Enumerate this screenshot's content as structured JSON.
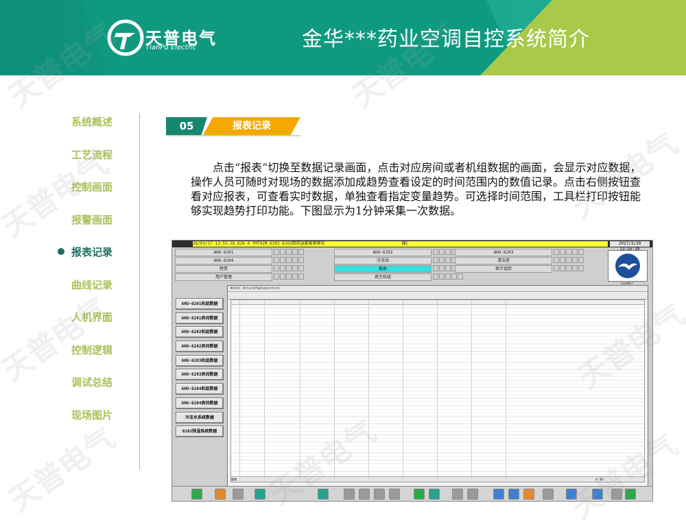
{
  "header": {
    "logo_text": "天普电气",
    "logo_sub": "TianPu Electric",
    "title": "金华***药业空调自控系统简介",
    "colors": {
      "primary": "#0f9a80",
      "accent": "#a8c94a"
    }
  },
  "nav": {
    "items": [
      {
        "label": "系统概述",
        "active": false
      },
      {
        "label": "工艺流程",
        "active": false
      },
      {
        "label": "控制画面",
        "active": false
      },
      {
        "label": "报警画面",
        "active": false
      },
      {
        "label": "报表记录",
        "active": true
      },
      {
        "label": "曲线记录",
        "active": false
      },
      {
        "label": "人机界面",
        "active": false
      },
      {
        "label": "控制逻辑",
        "active": false
      },
      {
        "label": "调试总结",
        "active": false
      },
      {
        "label": "现场图片",
        "active": false
      }
    ]
  },
  "section": {
    "number": "05",
    "title": "报表记录",
    "paragraph": "点击“报表”切换至数据记录画面，点击对应房间或者机组数据的画面，会显示对应数据，操作人员可随时对现场的数据添加成趋势查看设定的时间范围内的数值记录。点击右侧按钮查看对应报表，可查看实时数据，单独查看指定变量趋势。可选择时间范围，工具栏打印按钮能够实现趋势打印功能。下图显示为1分钟采集一次数据。"
  },
  "screenshot": {
    "alarm_bar": "28/03/17 13:55:28.826 0  TMT02M_6203                        6203回风湿度高限警告",
    "alarm_code": "偏C",
    "clock": "2017/3/20 13:55:39",
    "grid": [
      {
        "label": "AHU-6201",
        "col": 0,
        "row": 0,
        "cyan": false
      },
      {
        "label": "AHU-6202",
        "col": 1,
        "row": 0,
        "cyan": false
      },
      {
        "label": "AHU-6203",
        "col": 2,
        "row": 0,
        "cyan": false
      },
      {
        "label": "AHU-6204",
        "col": 0,
        "row": 1,
        "cyan": false
      },
      {
        "label": "冷冻站",
        "col": 1,
        "row": 1,
        "cyan": false
      },
      {
        "label": "清洁室",
        "col": 2,
        "row": 1,
        "cyan": false
      },
      {
        "label": "趋势",
        "col": 0,
        "row": 2,
        "cyan": false
      },
      {
        "label": "报表",
        "col": 1,
        "row": 2,
        "cyan": true
      },
      {
        "label": "审计追踪",
        "col": 2,
        "row": 2,
        "cyan": false
      },
      {
        "label": "用户管理",
        "col": 0,
        "row": 3,
        "cyan": false
      },
      {
        "label": "真空机组",
        "col": 1,
        "row": 3,
        "cyan": false
      }
    ],
    "logo_label": "Leader",
    "side_buttons": [
      "AHU-6201机组数据",
      "AHU-6201房间数据",
      "AHU-6202机组数据",
      "AHU-6202房间数据",
      "AHU-6203机组数据",
      "AHU-6203房间数据",
      "AHU-6204机组数据",
      "AHU-6204房间数据",
      "冷冻水系统数据",
      "6202除湿系统数据"
    ],
    "table_window_title": "WinCC OnlineTableControl",
    "table_status_left": "就绪",
    "table_status_right": "行 46"
  }
}
